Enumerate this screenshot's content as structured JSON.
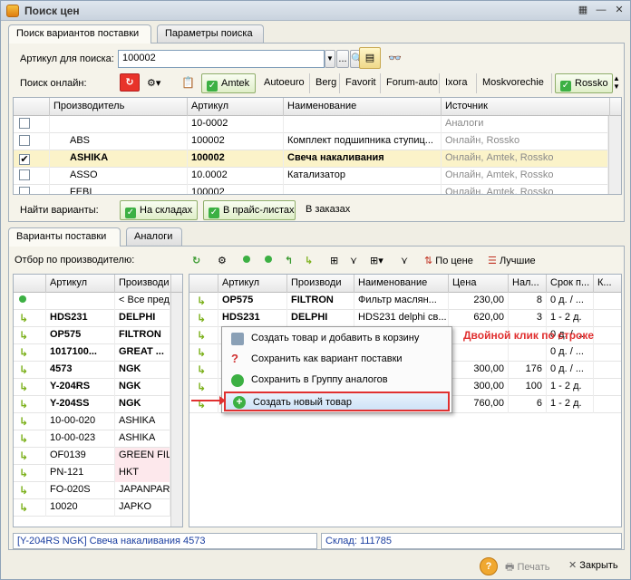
{
  "window": {
    "title": "Поиск цен"
  },
  "top_tabs": [
    "Поиск вариантов поставки",
    "Параметры поиска"
  ],
  "search": {
    "label": "Артикул для поиска:",
    "value": "100002"
  },
  "online": {
    "label": "Поиск онлайн:",
    "suppliers": [
      {
        "name": "Amtek",
        "on": true
      },
      {
        "name": "Autoeuro",
        "on": false
      },
      {
        "name": "Berg",
        "on": false
      },
      {
        "name": "Favorit",
        "on": false
      },
      {
        "name": "Forum-auto",
        "on": false
      },
      {
        "name": "Ixora",
        "on": false
      },
      {
        "name": "Moskvorechie",
        "on": false
      },
      {
        "name": "Rossko",
        "on": true
      }
    ]
  },
  "top_grid": {
    "columns": [
      "Производитель",
      "Артикул",
      "Наименование",
      "Источник"
    ],
    "rows": [
      {
        "check": "",
        "maker": "",
        "art": "10-0002",
        "name": "",
        "src": "Аналоги",
        "bold": false
      },
      {
        "check": "",
        "maker": "ABS",
        "art": "100002",
        "name": "Комплект подшипника ступиц...",
        "src": "Онлайн, Rossko",
        "bold": false
      },
      {
        "check": "✔",
        "maker": "ASHIKA",
        "art": "100002",
        "name": "Свеча накаливания",
        "src": "Онлайн, Amtek, Rossko",
        "bold": true
      },
      {
        "check": "",
        "maker": "ASSO",
        "art": "10.0002",
        "name": "Катализатор",
        "src": "Онлайн, Amtek, Rossko",
        "bold": false
      },
      {
        "check": "",
        "maker": "FEBI",
        "art": "100002",
        "name": "",
        "src": "Онлайн, Amtek, Rossko",
        "bold": false
      }
    ]
  },
  "find": {
    "label": "Найти варианты:",
    "stock": "На складах",
    "price": "В прайс-листах",
    "orders": "В заказах"
  },
  "bottom_tabs": [
    "Варианты поставки",
    "Аналоги"
  ],
  "filter_label": "Отбор по производителю:",
  "toolbar": {
    "by_price": "По цене",
    "best": "Лучшие"
  },
  "left_grid": {
    "columns": [
      "Артикул",
      "Производи"
    ],
    "rows": [
      {
        "icon": "dot",
        "art": "",
        "maker": "< Все пред",
        "bold": false
      },
      {
        "icon": "arrow",
        "art": "HDS231",
        "maker": "DELPHI",
        "bold": true
      },
      {
        "icon": "arrow",
        "art": "OP575",
        "maker": "FILTRON",
        "bold": true
      },
      {
        "icon": "arrow",
        "art": "1017100...",
        "maker": "GREAT ...",
        "bold": true
      },
      {
        "icon": "arrow",
        "art": "4573",
        "maker": "NGK",
        "bold": true
      },
      {
        "icon": "arrow",
        "art": "Y-204RS",
        "maker": "NGK",
        "bold": true
      },
      {
        "icon": "arrow",
        "art": "Y-204SS",
        "maker": "NGK",
        "bold": true
      },
      {
        "icon": "arrow",
        "art": "10-00-020",
        "maker": "ASHIKA",
        "bold": false
      },
      {
        "icon": "arrow",
        "art": "10-00-023",
        "maker": "ASHIKA",
        "bold": false
      },
      {
        "icon": "arrow",
        "art": "OF0139",
        "maker": "GREEN FIL",
        "bold": false
      },
      {
        "icon": "arrow",
        "art": "PN-121",
        "maker": "HKT",
        "bold": false
      },
      {
        "icon": "arrow",
        "art": "FO-020S",
        "maker": "JAPANPAR",
        "bold": false
      },
      {
        "icon": "arrow",
        "art": "10020",
        "maker": "JAPKO",
        "bold": false
      }
    ]
  },
  "right_grid": {
    "columns": [
      "Артикул",
      "Производи",
      "Наименование",
      "Цена",
      "Нал...",
      "Срок п...",
      "К..."
    ],
    "rows": [
      {
        "art": "OP575",
        "maker": "FILTRON",
        "name": "Фильтр маслян...",
        "price": "230,00",
        "qty": "8",
        "term": "0 д. / ...",
        "bold": true
      },
      {
        "art": "HDS231",
        "maker": "DELPHI",
        "name": "HDS231 delphi св...",
        "price": "620,00",
        "qty": "3",
        "term": "1 - 2 д.",
        "bold": true
      },
      {
        "art": "",
        "maker": "",
        "name": "",
        "price": "",
        "qty": "",
        "term": "0 д. / ...",
        "bold": false
      },
      {
        "art": "",
        "maker": "",
        "name": "",
        "price": "",
        "qty": "",
        "term": "0 д. / ...",
        "bold": false
      },
      {
        "art": "",
        "maker": "",
        "name": "",
        "price": "300,00",
        "qty": "176",
        "term": "0 д. / ...",
        "bold": false
      },
      {
        "art": "",
        "maker": "",
        "name": "",
        "price": "300,00",
        "qty": "100",
        "term": "1 - 2 д.",
        "bold": false
      },
      {
        "art": "",
        "maker": "",
        "name": "",
        "price": "760,00",
        "qty": "6",
        "term": "1 - 2 д.",
        "bold": false
      }
    ]
  },
  "context_menu": {
    "items": [
      "Создать товар и добавить в корзину",
      "Сохранить как вариант поставки",
      "Сохранить в Группу аналогов",
      "Создать новый товар"
    ]
  },
  "annotation": "Двойной клик по строке",
  "status": {
    "left": "[Y-204RS NGK]  Свеча накаливания 4573",
    "right": "Склад: 111785"
  },
  "footer": {
    "print": "Печать",
    "close": "Закрыть"
  }
}
